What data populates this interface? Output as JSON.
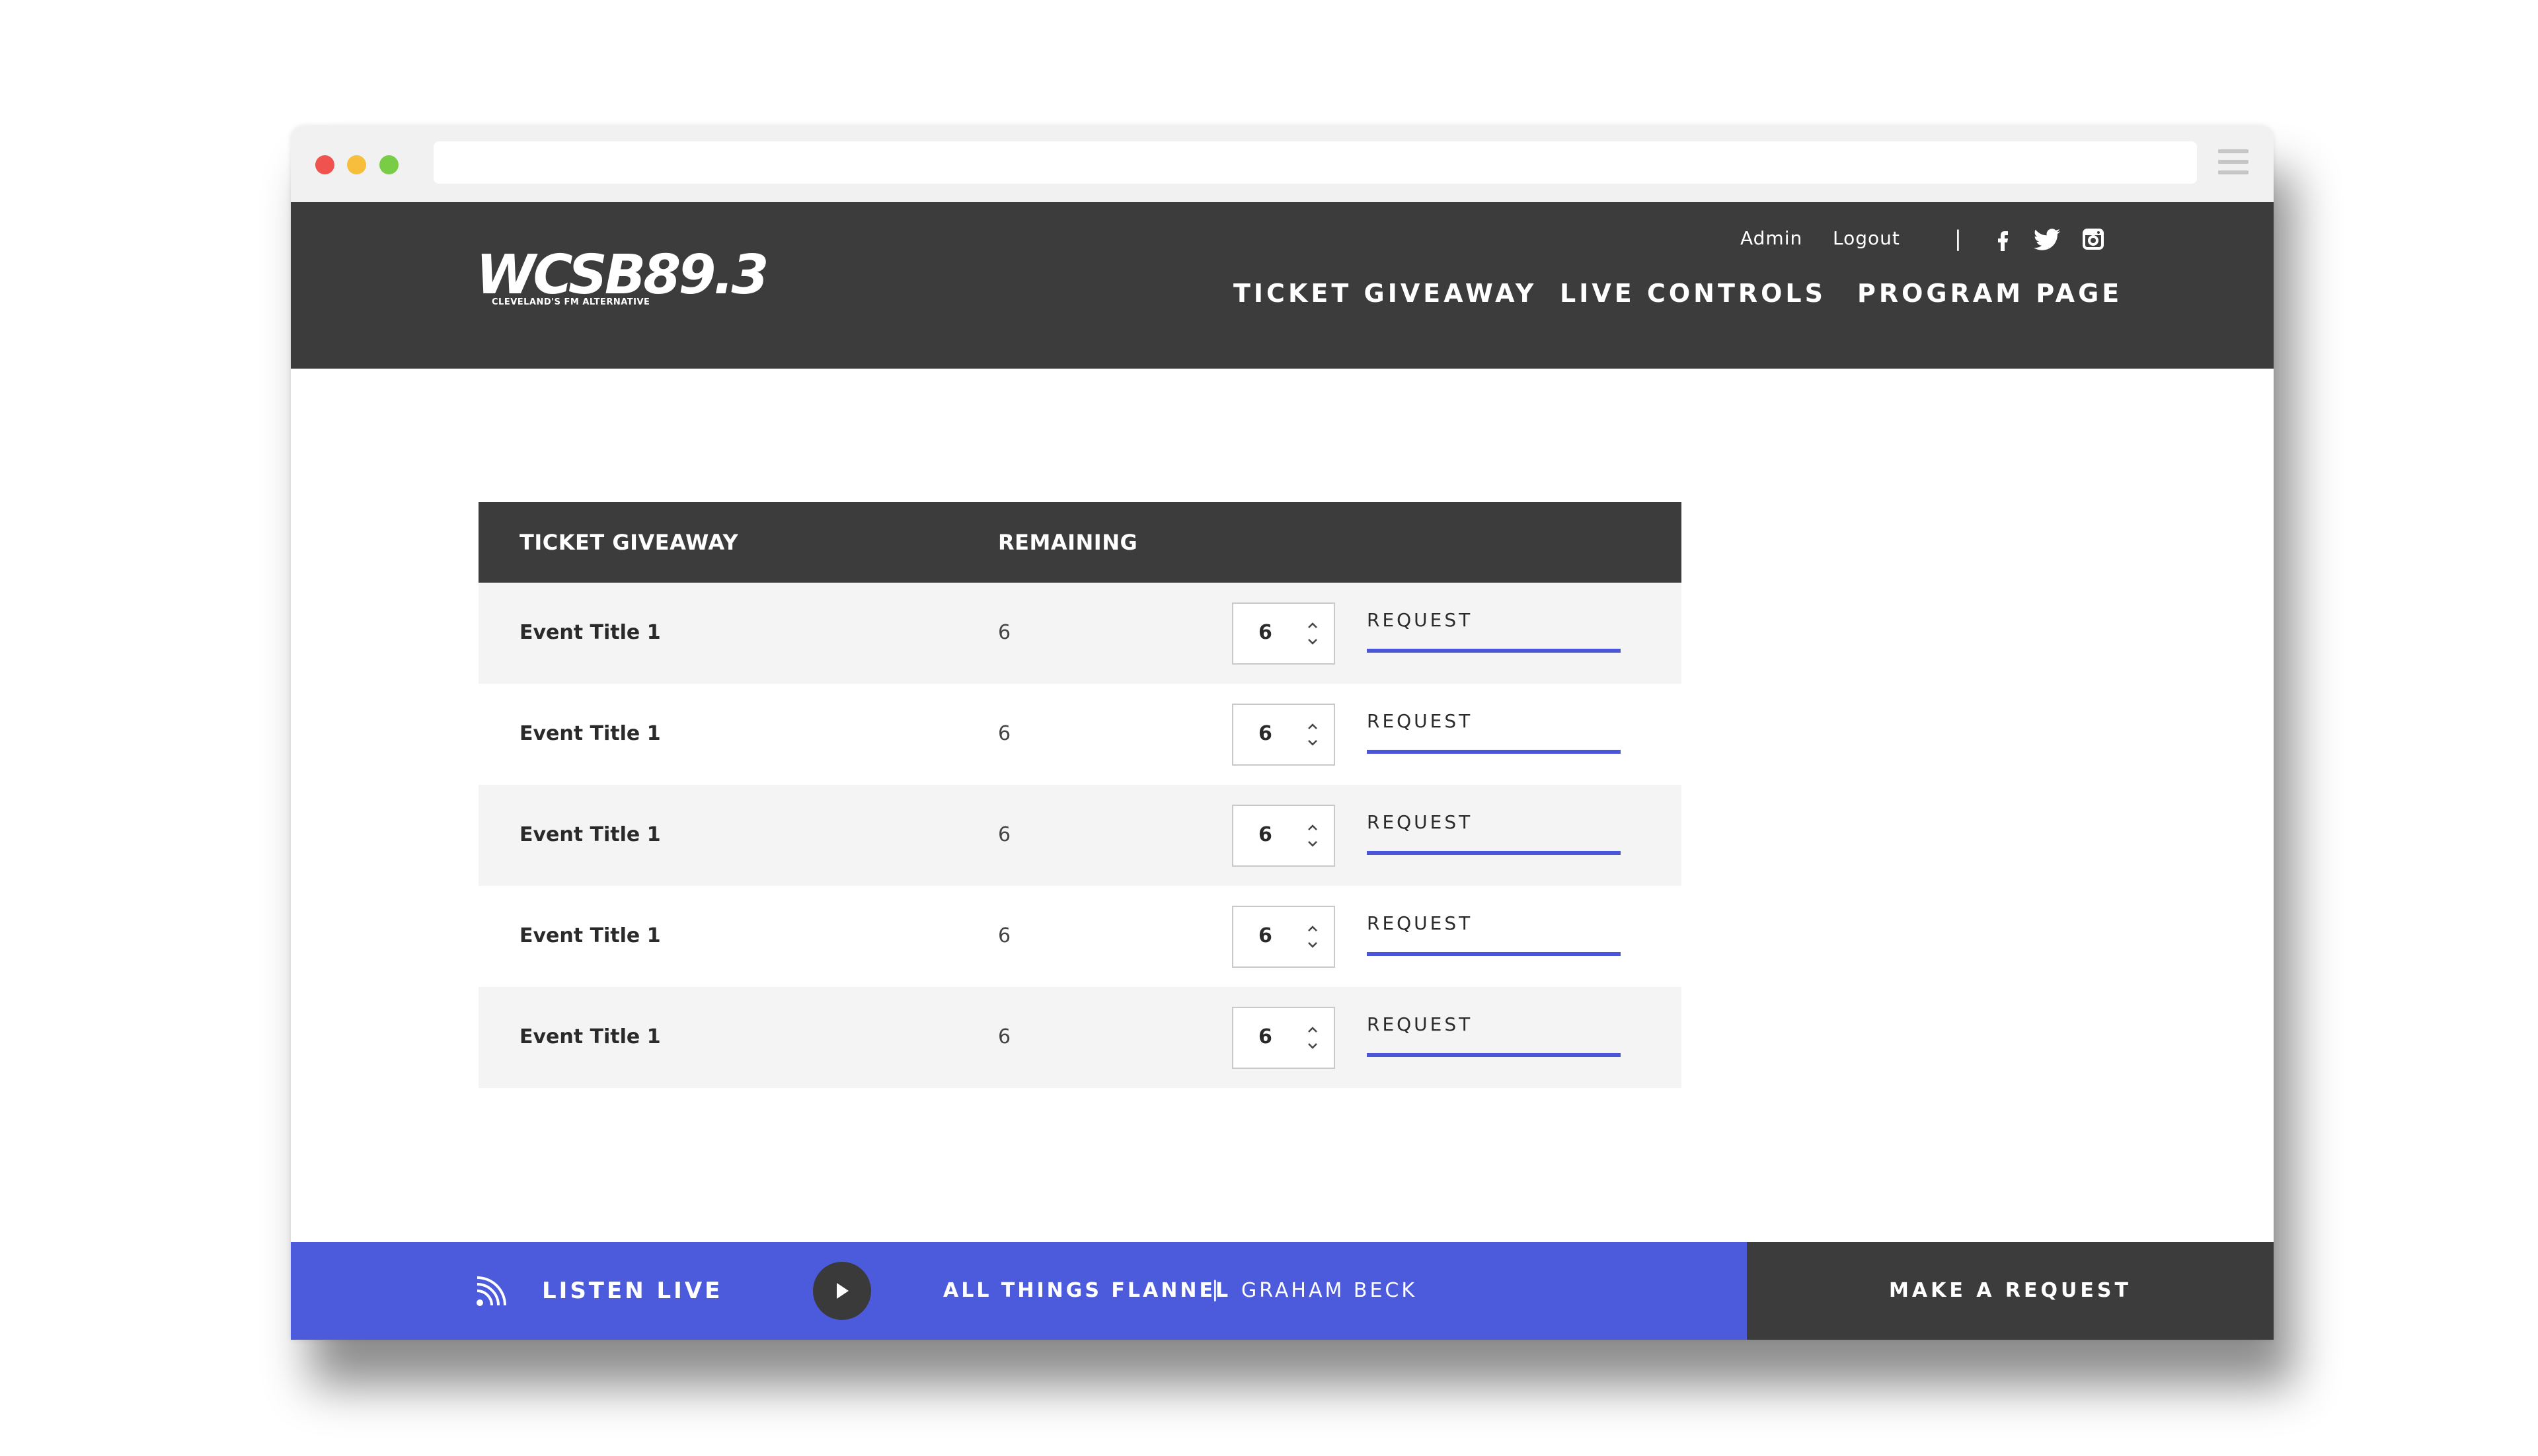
{
  "browser": {
    "address_value": ""
  },
  "header": {
    "logo_text": "WCSB89.3",
    "logo_tagline": "CLEVELAND'S FM ALTERNATIVE",
    "util_links": [
      "Admin",
      "Logout"
    ],
    "util_separator": "|",
    "social_icons": [
      "facebook-icon",
      "twitter-icon",
      "instagram-icon"
    ],
    "nav": [
      "TICKET GIVEAWAY",
      "LIVE CONTROLS",
      "PROGRAM PAGE"
    ]
  },
  "table": {
    "headers": [
      "TICKET GIVEAWAY",
      "REMAINING"
    ],
    "rows": [
      {
        "title": "Event Title 1",
        "remaining": "6",
        "quantity": "6",
        "action": "REQUEST"
      },
      {
        "title": "Event Title 1",
        "remaining": "6",
        "quantity": "6",
        "action": "REQUEST"
      },
      {
        "title": "Event Title 1",
        "remaining": "6",
        "quantity": "6",
        "action": "REQUEST"
      },
      {
        "title": "Event Title 1",
        "remaining": "6",
        "quantity": "6",
        "action": "REQUEST"
      },
      {
        "title": "Event Title 1",
        "remaining": "6",
        "quantity": "6",
        "action": "REQUEST"
      }
    ]
  },
  "footer": {
    "listen_live": "LISTEN LIVE",
    "show_name": "ALL THINGS FLANNEL",
    "separator": "|",
    "host_name": "GRAHAM BECK",
    "cta": "MAKE A REQUEST"
  },
  "colors": {
    "header_bg": "#3c3c3c",
    "accent_blue": "#4c5bdb",
    "row_alt": "#f4f4f4"
  }
}
